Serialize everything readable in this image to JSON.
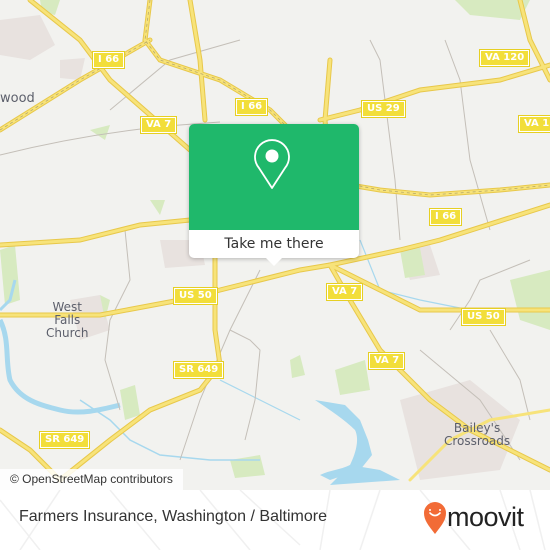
{
  "map": {
    "colors": {
      "background": "#f2f2ef",
      "road": "#f5dd63",
      "road_casing": "#e8c84a",
      "water": "#a7d8ee",
      "park": "#d7eac0",
      "urban": "#e8e2df",
      "minor_road": "#b9b3ab"
    },
    "shields": [
      {
        "label": "I 66"
      },
      {
        "label": "I 66"
      },
      {
        "label": "VA 7"
      },
      {
        "label": "US 29"
      },
      {
        "label": "VA 120"
      },
      {
        "label": "VA 1"
      },
      {
        "label": "I 66"
      },
      {
        "label": "US 50"
      },
      {
        "label": "VA 7"
      },
      {
        "label": "US 50"
      },
      {
        "label": "SR 649"
      },
      {
        "label": "VA 7"
      },
      {
        "label": "SR 649"
      }
    ],
    "places": [
      {
        "label": "wood"
      },
      {
        "label": "West\nFalls\nChurch"
      },
      {
        "label": "Bailey's\nCrossroads"
      }
    ],
    "attribution": "© OpenStreetMap contributors"
  },
  "popup": {
    "icon": "map-pin-icon",
    "button_label": "Take me there",
    "color": "#1fb86b"
  },
  "footer": {
    "title": "Farmers Insurance, Washington / Baltimore",
    "brand": "moovit",
    "brand_icon": "moovit-smiley-pin-icon",
    "brand_color": "#f26b36"
  }
}
